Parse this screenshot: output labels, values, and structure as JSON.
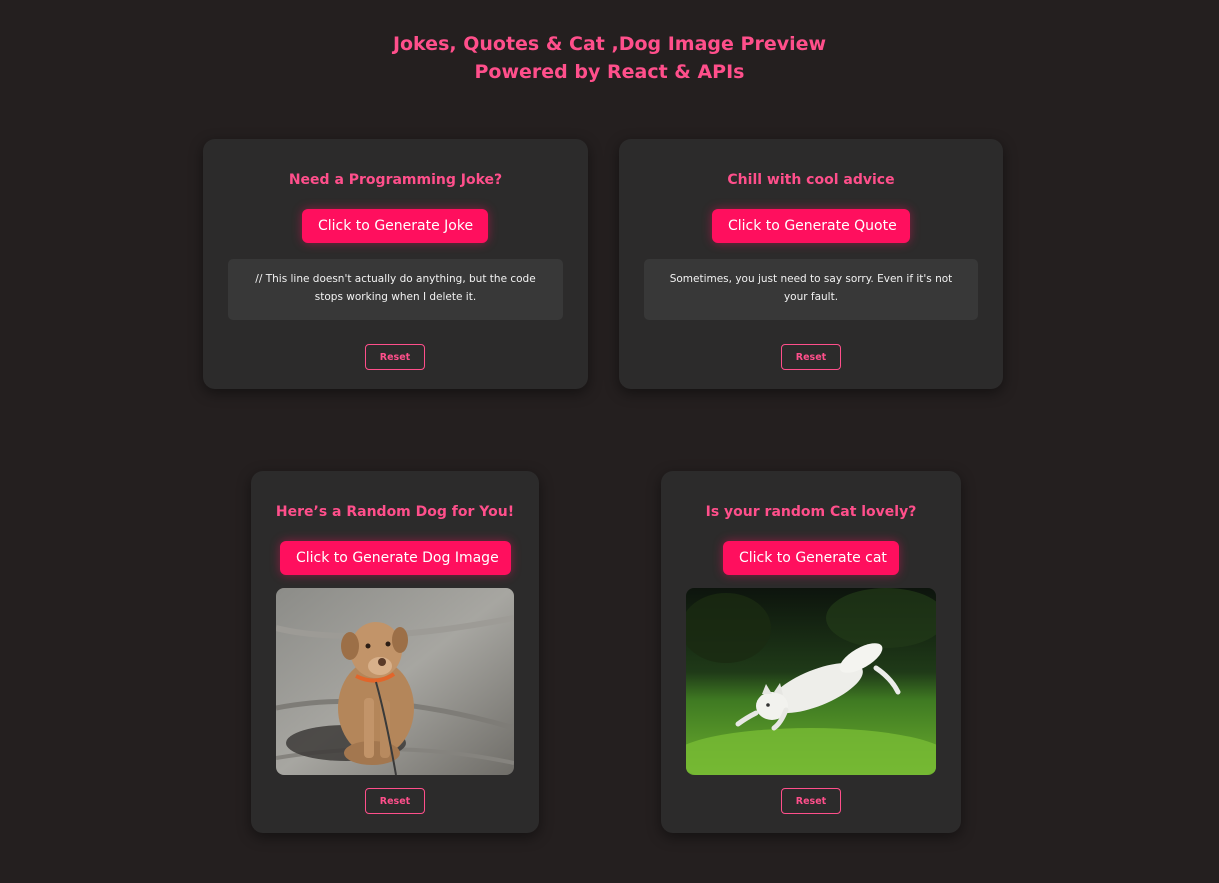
{
  "header": {
    "line1": "Jokes, Quotes & Cat ,Dog Image Preview",
    "line2": "Powered by React & APIs"
  },
  "joke_card": {
    "title": "Need a Programming Joke?",
    "button": "Click to Generate Joke",
    "text": "// This line doesn't actually do anything, but the code stops working when I delete it.",
    "reset": "Reset"
  },
  "quote_card": {
    "title": "Chill with cool advice",
    "button": "Click to Generate Quote",
    "text": "Sometimes, you just need to say sorry. Even if it's not your fault.",
    "reset": "Reset"
  },
  "dog_card": {
    "title": "Here’s a Random Dog for You!",
    "button": "Click to Generate Dog Image",
    "reset": "Reset"
  },
  "cat_card": {
    "title": "Is your random Cat lovely?",
    "button": "Click to Generate cat",
    "reset": "Reset"
  },
  "colors": {
    "background": "#241f1f",
    "card": "#2c2b2b",
    "accent": "#ff4f8b",
    "button": "#ff0f5e"
  }
}
